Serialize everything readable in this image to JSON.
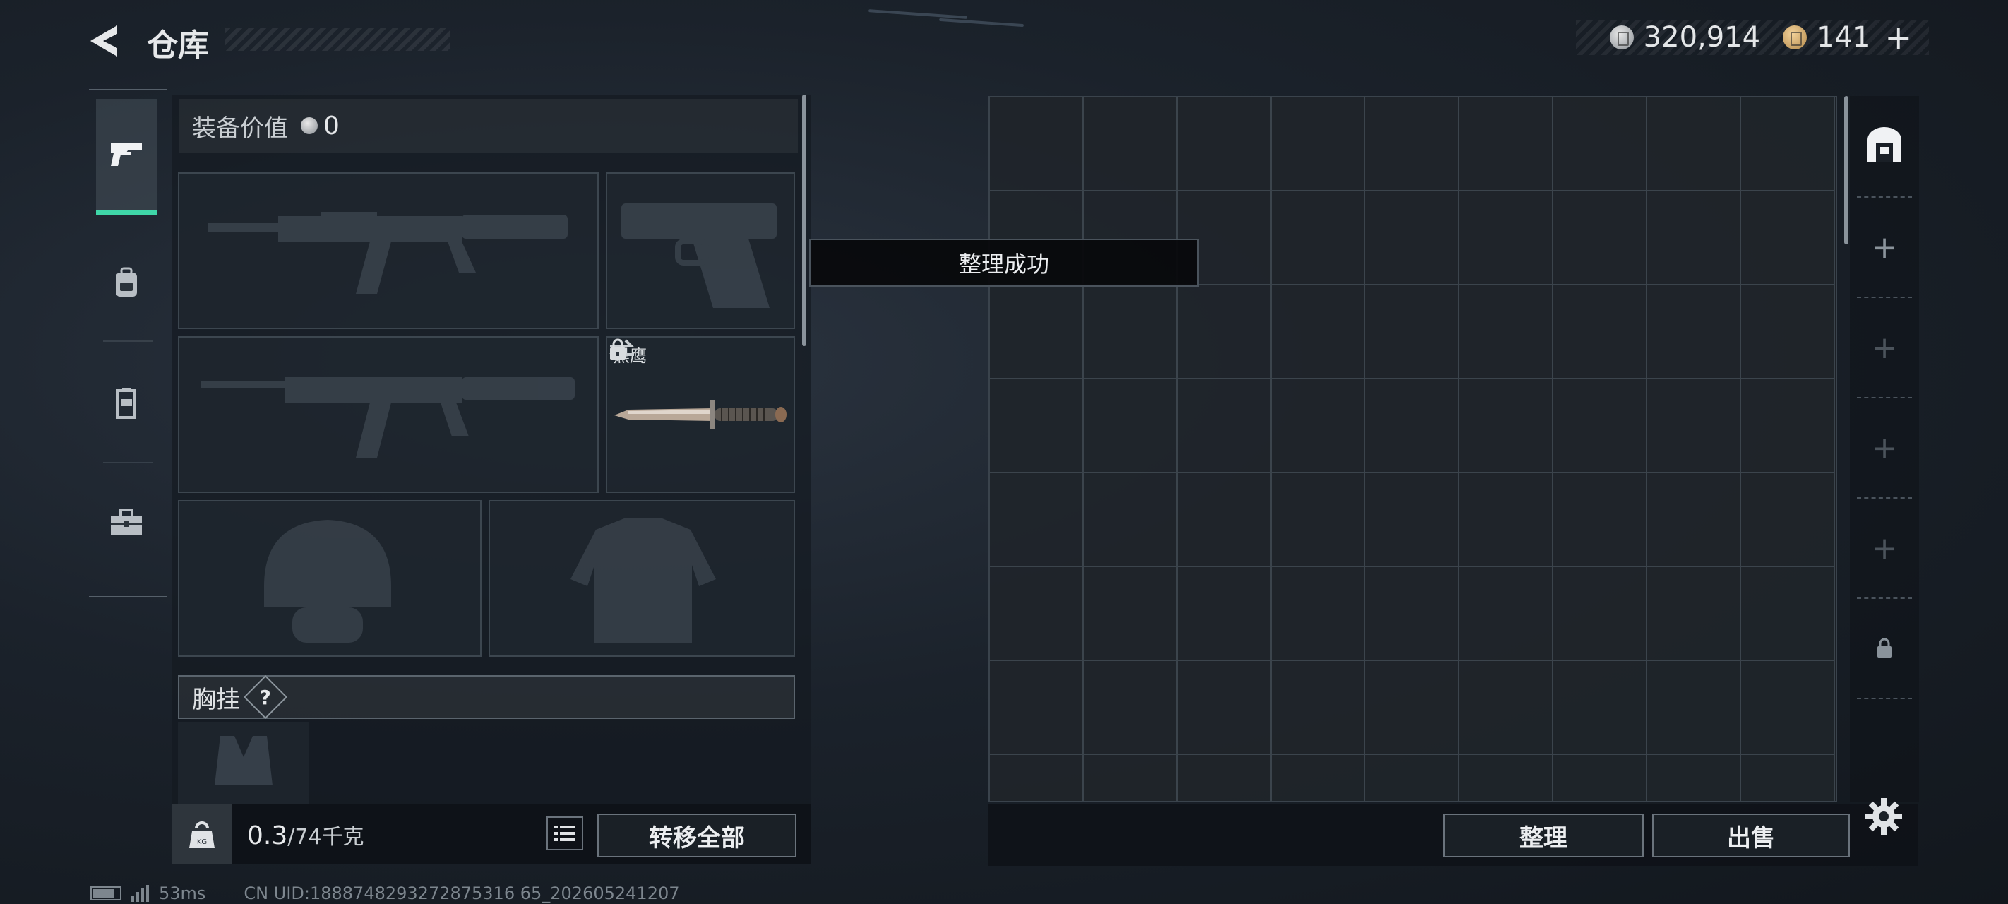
{
  "header": {
    "title": "仓库",
    "currencies": [
      {
        "icon": "silver-coin-icon",
        "value": "320,914"
      },
      {
        "icon": "gold-coin-icon",
        "value": "141"
      }
    ],
    "add_label": "+"
  },
  "left_nav": {
    "items": [
      {
        "name": "weapons",
        "icon": "pistol-icon",
        "active": true
      },
      {
        "name": "backpack",
        "icon": "backpack-icon",
        "active": false
      },
      {
        "name": "armor",
        "icon": "vest-icon",
        "active": false
      },
      {
        "name": "toolbox",
        "icon": "toolbox-icon",
        "active": false
      }
    ]
  },
  "loadout": {
    "equip_value_label": "装备价值",
    "equip_value": "0",
    "slots": [
      {
        "id": "primary-weapon-1",
        "icon": "rifle-icon",
        "label": ""
      },
      {
        "id": "sidearm",
        "icon": "pistol-icon",
        "label": ""
      },
      {
        "id": "primary-weapon-2",
        "icon": "rifle-icon",
        "label": ""
      },
      {
        "id": "melee",
        "icon": "knife-icon",
        "label": "黑鹰",
        "locked": true
      },
      {
        "id": "helmet",
        "icon": "helmet-icon",
        "label": ""
      },
      {
        "id": "body-armor",
        "icon": "armor-icon",
        "label": ""
      }
    ],
    "chest_rig_label": "胸挂",
    "help_label": "?",
    "weight": {
      "current": "0.3",
      "max": "/74千克"
    },
    "transfer_all_label": "转移全部"
  },
  "toast": {
    "text": "整理成功"
  },
  "storage": {
    "sort_label": "整理",
    "sell_label": "出售",
    "side_slots": [
      "+",
      "+",
      "+",
      "+"
    ]
  },
  "status": {
    "ping": "53ms",
    "uid": "CN UID:1888748293272875316 65_202605241207"
  },
  "colors": {
    "accent": "#3fd6a8",
    "panel": "#1c2128",
    "border": "#3b444c"
  }
}
